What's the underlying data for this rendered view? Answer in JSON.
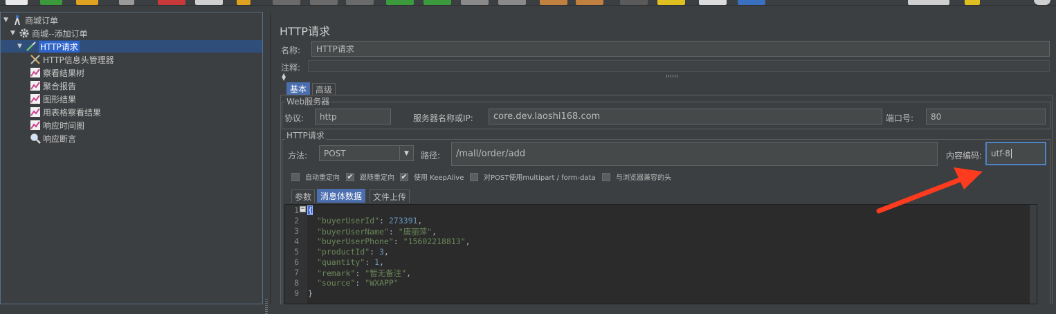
{
  "tree": {
    "root": "商城订单",
    "thread_group": "商城--添加订单",
    "sampler": "HTTP请求",
    "children": [
      "HTTP信息头管理器",
      "察看结果树",
      "聚合报告",
      "图形结果",
      "用表格察看结果",
      "响应时间图",
      "响应断言"
    ]
  },
  "panel": {
    "title": "HTTP请求",
    "name_label": "名称:",
    "name_value": "HTTP请求",
    "comment_label": "注释:",
    "tabs": [
      "基本",
      "高级"
    ]
  },
  "web_server": {
    "group_title": "Web服务器",
    "protocol_label": "协议:",
    "protocol_value": "http",
    "server_label": "服务器名称或IP:",
    "server_value": "core.dev.laoshi168.com",
    "port_label": "端口号:",
    "port_value": "80"
  },
  "http_request": {
    "group_title": "HTTP请求",
    "method_label": "方法:",
    "method_value": "POST",
    "path_label": "路径:",
    "path_value": "/mall/order/add",
    "encoding_label": "内容编码:",
    "encoding_value": "utf-8",
    "checkboxes": [
      {
        "label": "自动重定向",
        "checked": false
      },
      {
        "label": "跟随重定向",
        "checked": true
      },
      {
        "label": "使用 KeepAlive",
        "checked": true
      },
      {
        "label": "对POST使用multipart / form-data",
        "checked": false
      },
      {
        "label": "与浏览器兼容的头",
        "checked": false
      }
    ],
    "sub_tabs": [
      "参数",
      "消息体数据",
      "文件上传"
    ]
  },
  "body_editor": {
    "line_numbers": [
      "1",
      "2",
      "3",
      "4",
      "5",
      "6",
      "7",
      "8",
      "9"
    ],
    "lines": [
      {
        "key": "",
        "sep": "",
        "val": "",
        "end": ""
      },
      {
        "key": "\"buyerUserId\"",
        "sep": ": ",
        "val": "273391",
        "end": ","
      },
      {
        "key": "\"buyerUserName\"",
        "sep": ": ",
        "val": "\"唐丽萍\"",
        "end": ","
      },
      {
        "key": "\"buyerUserPhone\"",
        "sep": ": ",
        "val": "\"15602218813\"",
        "end": ","
      },
      {
        "key": "\"productId\"",
        "sep": ": ",
        "val": "3",
        "end": ","
      },
      {
        "key": "\"quantity\"",
        "sep": ": ",
        "val": "1",
        "end": ","
      },
      {
        "key": "\"remark\"",
        "sep": ": ",
        "val": "\"暂无备注\"",
        "end": ","
      },
      {
        "key": "\"source\"",
        "sep": ": ",
        "val": "\"WXAPP\"",
        "end": ""
      },
      {
        "key": "",
        "sep": "",
        "val": "}",
        "end": ""
      }
    ],
    "open_brace": "{"
  },
  "colors": {
    "annotation_arrow": "#ff3b1f",
    "selection": "#2f65ca",
    "active_tab": "#4b6eaf"
  }
}
